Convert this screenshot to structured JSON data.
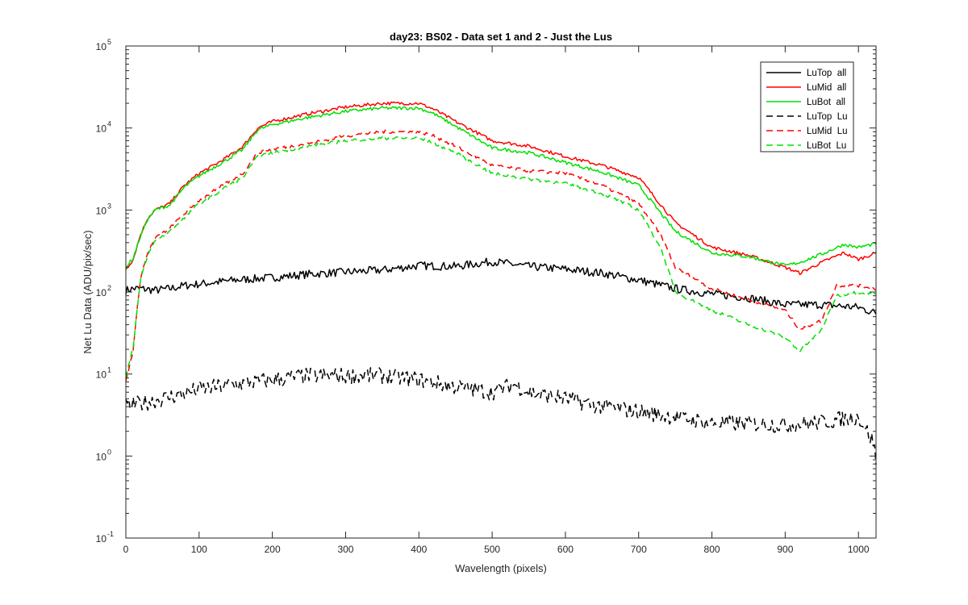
{
  "chart_data": {
    "type": "line",
    "title": "day23: BS02 - Data set 1 and 2 - Just the Lus",
    "xlabel": "Wavelength (pixels)",
    "ylabel": "Net Lu Data (ADU/pix/sec)",
    "xlim": [
      0,
      1024
    ],
    "ylim": [
      0.1,
      100000
    ],
    "yscale": "log",
    "x_ticks": [
      0,
      100,
      200,
      300,
      400,
      500,
      600,
      700,
      800,
      900,
      1000
    ],
    "y_ticks": [
      {
        "base": "10",
        "exp": "-1",
        "value": 0.1
      },
      {
        "base": "10",
        "exp": "0",
        "value": 1
      },
      {
        "base": "10",
        "exp": "1",
        "value": 10
      },
      {
        "base": "10",
        "exp": "2",
        "value": 100
      },
      {
        "base": "10",
        "exp": "3",
        "value": 1000
      },
      {
        "base": "10",
        "exp": "4",
        "value": 10000
      },
      {
        "base": "10",
        "exp": "5",
        "value": 100000
      }
    ],
    "grid": false,
    "legend_position": "top-right",
    "series": [
      {
        "name": "LuTop  all",
        "color": "#000000",
        "dash": "solid",
        "x": [
          0,
          10,
          20,
          40,
          60,
          80,
          100,
          150,
          200,
          250,
          300,
          350,
          400,
          450,
          500,
          550,
          600,
          650,
          700,
          750,
          800,
          850,
          900,
          950,
          1000,
          1024
        ],
        "y": [
          105,
          110,
          110,
          105,
          110,
          120,
          125,
          140,
          150,
          165,
          175,
          185,
          210,
          205,
          235,
          205,
          190,
          170,
          140,
          110,
          95,
          85,
          70,
          70,
          65,
          55
        ]
      },
      {
        "name": "LuMid  all",
        "color": "#ff0000",
        "dash": "solid",
        "x": [
          0,
          10,
          20,
          30,
          40,
          60,
          80,
          100,
          120,
          140,
          160,
          180,
          200,
          250,
          300,
          350,
          400,
          420,
          450,
          500,
          550,
          600,
          650,
          700,
          750,
          800,
          850,
          900,
          920,
          950,
          980,
          1000,
          1024
        ],
        "y": [
          190,
          250,
          500,
          800,
          1000,
          1200,
          2000,
          2800,
          3500,
          4500,
          6000,
          10000,
          12000,
          15000,
          18000,
          20000,
          20000,
          17000,
          12000,
          7000,
          6000,
          4500,
          3500,
          2500,
          700,
          350,
          280,
          200,
          170,
          230,
          300,
          250,
          300
        ]
      },
      {
        "name": "LuBot  all",
        "color": "#00e000",
        "dash": "solid",
        "x": [
          0,
          10,
          20,
          30,
          40,
          60,
          80,
          100,
          120,
          140,
          160,
          180,
          200,
          250,
          300,
          350,
          400,
          420,
          450,
          500,
          550,
          600,
          650,
          700,
          750,
          800,
          850,
          900,
          920,
          950,
          980,
          1000,
          1024
        ],
        "y": [
          200,
          260,
          480,
          780,
          1000,
          1150,
          1900,
          2600,
          3300,
          4200,
          5500,
          9500,
          11000,
          13500,
          16000,
          17500,
          17500,
          15000,
          10500,
          5700,
          5000,
          3800,
          2900,
          2000,
          550,
          300,
          270,
          210,
          230,
          290,
          380,
          350,
          390
        ]
      },
      {
        "name": "LuTop  Lu",
        "color": "#000000",
        "dash": "dashed",
        "x": [
          0,
          50,
          100,
          150,
          200,
          250,
          300,
          350,
          400,
          450,
          500,
          530,
          550,
          600,
          650,
          700,
          750,
          800,
          850,
          900,
          950,
          1000,
          1020,
          1024
        ],
        "y": [
          4,
          5,
          6.5,
          7.5,
          8.5,
          9.5,
          9.5,
          9.5,
          8.5,
          7,
          6,
          7.5,
          6,
          5,
          4,
          3.5,
          3,
          2.5,
          2.5,
          2.4,
          2.6,
          3,
          1.5,
          0.9
        ]
      },
      {
        "name": "LuMid  Lu",
        "color": "#ff0000",
        "dash": "dashed",
        "x": [
          0,
          10,
          20,
          30,
          40,
          60,
          80,
          100,
          120,
          140,
          160,
          180,
          200,
          250,
          300,
          350,
          400,
          420,
          450,
          500,
          550,
          600,
          650,
          700,
          730,
          750,
          800,
          850,
          900,
          920,
          950,
          970,
          1000,
          1024
        ],
        "y": [
          8,
          20,
          150,
          300,
          450,
          600,
          900,
          1300,
          1700,
          2200,
          2800,
          5000,
          5500,
          6500,
          8000,
          9000,
          9000,
          8000,
          6000,
          3500,
          3000,
          2800,
          2000,
          1200,
          500,
          200,
          110,
          80,
          60,
          35,
          45,
          120,
          120,
          110
        ]
      },
      {
        "name": "LuBot  Lu",
        "color": "#00e000",
        "dash": "dashed",
        "x": [
          0,
          10,
          20,
          30,
          40,
          60,
          80,
          100,
          120,
          140,
          160,
          180,
          200,
          250,
          300,
          350,
          400,
          420,
          450,
          500,
          550,
          600,
          650,
          700,
          730,
          750,
          800,
          850,
          900,
          920,
          950,
          970,
          1000,
          1024
        ],
        "y": [
          9,
          22,
          140,
          280,
          420,
          550,
          800,
          1200,
          1500,
          2000,
          2500,
          4500,
          5000,
          6000,
          7000,
          7500,
          7500,
          6500,
          5000,
          2800,
          2400,
          2100,
          1600,
          1000,
          350,
          100,
          60,
          40,
          28,
          19,
          35,
          90,
          100,
          95
        ]
      }
    ]
  }
}
